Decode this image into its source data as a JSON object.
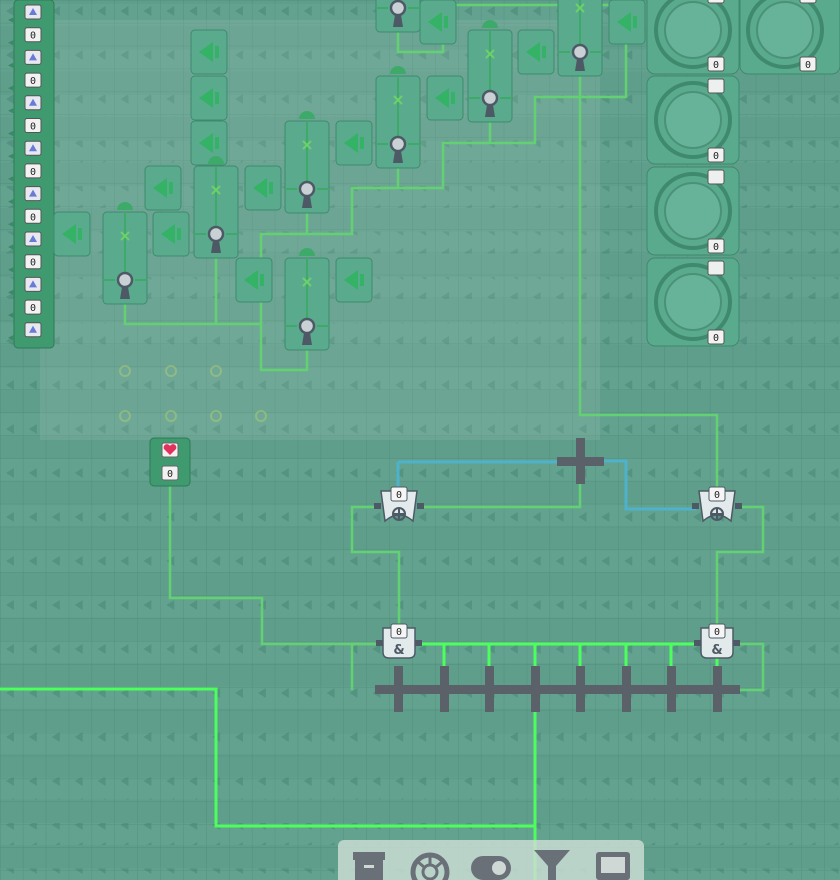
{
  "colors": {
    "background": "#5e9e8a",
    "stripe": "#6aa894",
    "wire_active": "#4dff5c",
    "wire_dim": "#63d173",
    "wire_blue": "#4fb2cc",
    "machine_fill": "#5aaa8e",
    "machine_stroke": "#3f8a6f",
    "gate_fill": "#e3eaec",
    "gate_stroke": "#4d5a66",
    "bus_bar": "#5a6169",
    "sensor_heart": "#e0325c"
  },
  "left_column": {
    "counters": [
      "0",
      "0",
      "0",
      "0",
      "0",
      "0",
      "0",
      "0"
    ]
  },
  "reactors": {
    "counters": [
      "0",
      "0",
      "0",
      "0",
      "0",
      "0"
    ]
  },
  "sensor": {
    "icon": "heart-sensor-icon",
    "value": "0"
  },
  "gates": {
    "or_left_label": "0",
    "or_right_label": "0",
    "and_left_label": "0",
    "and_right_label": "0"
  },
  "toolbar": {
    "items": [
      "storage-crate-icon",
      "gauge-icon",
      "toggle-switch-icon",
      "filter-funnel-icon",
      "monitor-icon"
    ]
  }
}
